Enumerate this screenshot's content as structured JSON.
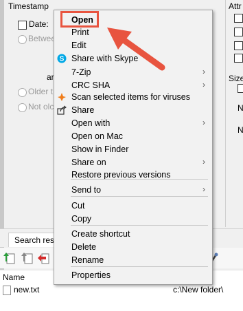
{
  "background": {
    "timestamp_label": "Timestamp",
    "date_label": "Date:",
    "between_label": "Betwee",
    "and_label": "ar",
    "older_label": "Older t",
    "not_older_label": "Not olc",
    "attributes_label": "Attr",
    "size_label": "Size",
    "side_n1": "N",
    "side_n2": "N",
    "search_tab_label": "Search resu",
    "col_name": "Name",
    "file_name": "new.txt",
    "file_path": "c:\\New folder\\"
  },
  "menu": {
    "items": [
      {
        "label": "Open",
        "bold": true
      },
      {
        "label": "Print"
      },
      {
        "label": "Edit"
      },
      {
        "label": "Share with Skype",
        "icon": "skype-icon"
      },
      {
        "label": "7-Zip",
        "submenu": true
      },
      {
        "label": "CRC SHA",
        "submenu": true
      },
      {
        "label": "Scan selected items for viruses",
        "icon": "avast-icon"
      },
      {
        "label": "Share",
        "icon": "share-icon"
      },
      {
        "label": "Open with",
        "submenu": true
      },
      {
        "label": "Open on Mac"
      },
      {
        "label": "Show in Finder"
      },
      {
        "label": "Share on",
        "submenu": true
      },
      {
        "label": "Restore previous versions"
      },
      {
        "label": "Send to",
        "submenu": true
      },
      {
        "label": "Cut"
      },
      {
        "label": "Copy"
      },
      {
        "label": "Create shortcut"
      },
      {
        "label": "Delete"
      },
      {
        "label": "Rename"
      },
      {
        "label": "Properties"
      }
    ],
    "submenu_arrow": "›"
  },
  "annotation": {
    "highlight_color": "#e8543f",
    "arrow_color": "#e8543f"
  }
}
